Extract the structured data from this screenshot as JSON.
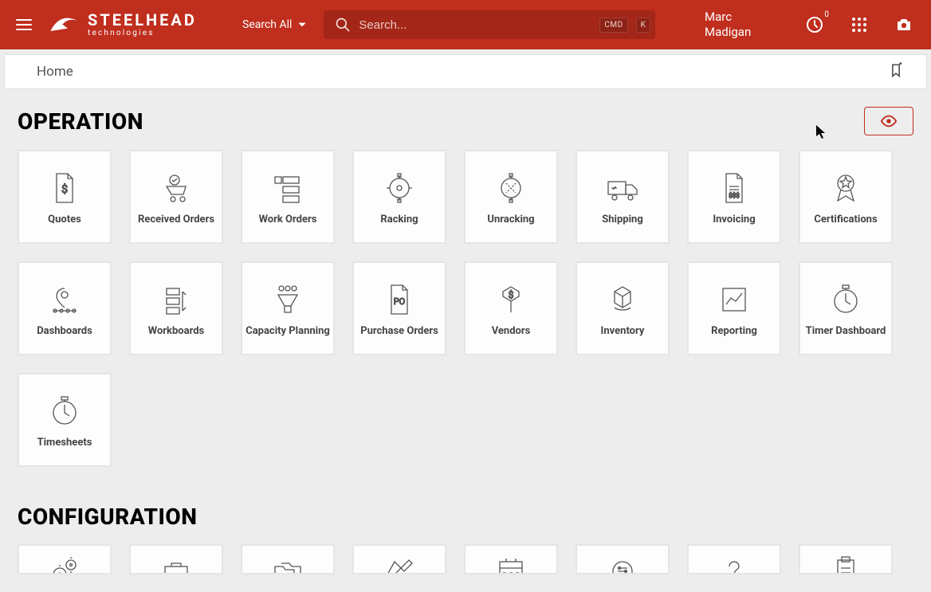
{
  "brand": {
    "name": "STEELHEAD",
    "sub": "technologies"
  },
  "header": {
    "search_scope_label": "Search All",
    "search_placeholder": "Search...",
    "kbd_cmd": "CMD",
    "kbd_k": "K",
    "username": "Marc Madigan",
    "clock_badge": "0"
  },
  "breadcrumb": {
    "label": "Home"
  },
  "sections": {
    "operation_title": "OPERATION",
    "configuration_title": "CONFIGURATION"
  },
  "operation_tiles": [
    {
      "label": "Quotes",
      "icon": "quote-doc"
    },
    {
      "label": "Received Orders",
      "icon": "received-orders"
    },
    {
      "label": "Work Orders",
      "icon": "work-orders"
    },
    {
      "label": "Racking",
      "icon": "racking"
    },
    {
      "label": "Unracking",
      "icon": "unracking"
    },
    {
      "label": "Shipping",
      "icon": "shipping"
    },
    {
      "label": "Invoicing",
      "icon": "invoicing"
    },
    {
      "label": "Certifications",
      "icon": "certifications"
    },
    {
      "label": "Dashboards",
      "icon": "dashboards"
    },
    {
      "label": "Workboards",
      "icon": "workboards"
    },
    {
      "label": "Capacity Planning",
      "icon": "capacity"
    },
    {
      "label": "Purchase Orders",
      "icon": "purchase-orders"
    },
    {
      "label": "Vendors",
      "icon": "vendors"
    },
    {
      "label": "Inventory",
      "icon": "inventory"
    },
    {
      "label": "Reporting",
      "icon": "reporting"
    },
    {
      "label": "Timer Dashboard",
      "icon": "timer"
    },
    {
      "label": "Timesheets",
      "icon": "timer"
    }
  ],
  "configuration_tiles": [
    {
      "icon": "gears"
    },
    {
      "icon": "briefcase"
    },
    {
      "icon": "folders"
    },
    {
      "icon": "hammer"
    },
    {
      "icon": "calendar"
    },
    {
      "icon": "cog-sliders"
    },
    {
      "icon": "question"
    },
    {
      "icon": "clipboard"
    }
  ]
}
